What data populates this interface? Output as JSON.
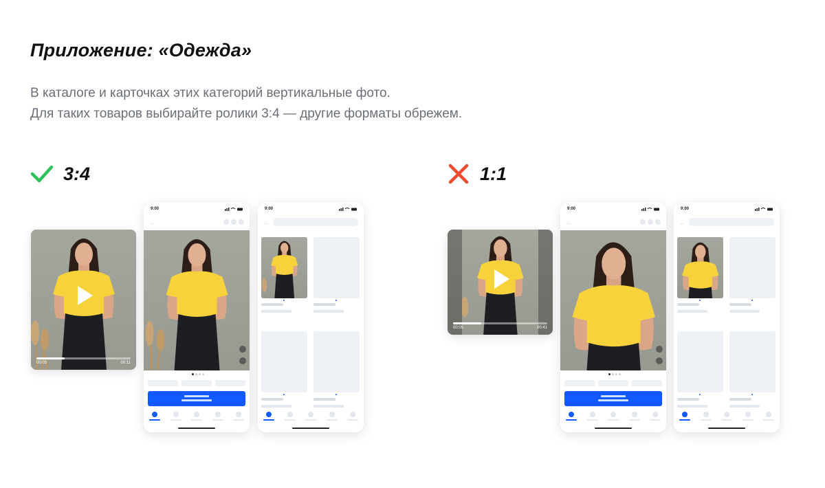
{
  "title": "Приложение: «Одежда»",
  "description": {
    "line1": "В каталоге и карточках этих категорий вертикальные фото.",
    "line2": "Для таких товаров выбирайте ролики 3:4 — другие форматы обрежем."
  },
  "good": {
    "label": "3:4",
    "icon": "check-icon",
    "color": "#2ec15a",
    "video_time_start": "00:05",
    "video_time_end": "00:11",
    "video_progress": 0.3
  },
  "bad": {
    "label": "1:1",
    "icon": "cross-icon",
    "color": "#ee4a33",
    "video_time_start": "00:05",
    "video_time_end": "00:41",
    "video_progress": 0.3
  },
  "phone": {
    "time": "9:00"
  },
  "colors": {
    "accent": "#1259ff",
    "shirt": "#f7d23a",
    "wall": "#9ba096"
  }
}
